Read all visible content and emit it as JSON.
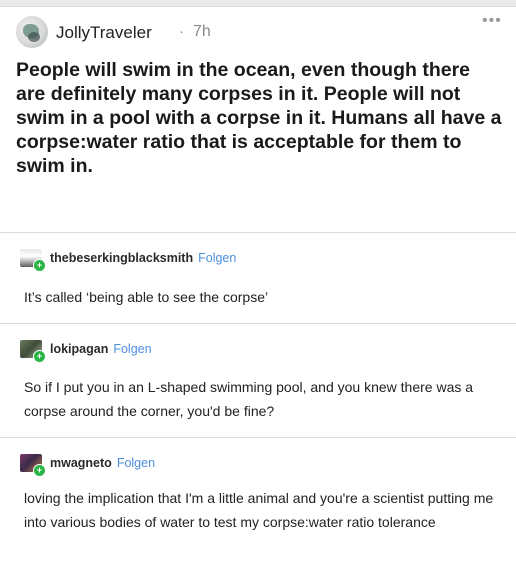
{
  "post": {
    "username": "JollyTraveler",
    "separator": "·",
    "time": "7h",
    "more_icon": "ellipsis-icon",
    "body": "People will swim in the ocean, even though there are definitely many corpses in it. People will not swim in a pool with a corpse in it. Humans all have a corpse:water ratio that is acceptable for them to swim in."
  },
  "replies": [
    {
      "username": "thebeserkingblacksmith",
      "follow_label": "Folgen",
      "text": "It’s called ‘being able to see the corpse’"
    },
    {
      "username": "lokipagan",
      "follow_label": "Folgen",
      "text": "So if I put you in an L-shaped swimming pool, and you knew there was a corpse around the corner, you'd be fine?"
    },
    {
      "username": "mwagneto",
      "follow_label": "Folgen",
      "text": "loving the implication that I'm a little animal and you're a scientist putting me into various bodies of water to test my corpse:water ratio tolerance"
    }
  ],
  "colors": {
    "follow_link": "#4e8ee0",
    "badge": "#29b545",
    "divider": "#dcdcdc"
  }
}
